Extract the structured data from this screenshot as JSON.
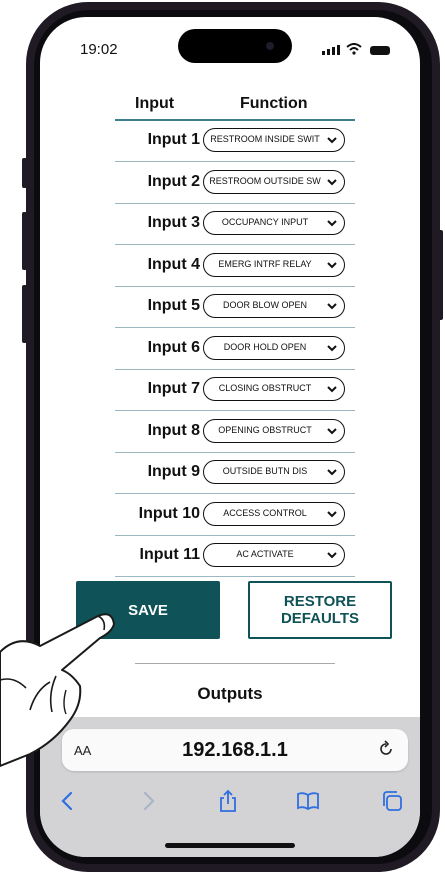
{
  "status_bar": {
    "time": "19:02"
  },
  "table": {
    "header_input": "Input",
    "header_function": "Function",
    "rows": [
      {
        "input": "Input 1",
        "function": "RESTROOM INSIDE SWIT"
      },
      {
        "input": "Input 2",
        "function": "RESTROOM OUTSIDE SW"
      },
      {
        "input": "Input 3",
        "function": "OCCUPANCY INPUT"
      },
      {
        "input": "Input 4",
        "function": "EMERG INTRF RELAY"
      },
      {
        "input": "Input 5",
        "function": "DOOR BLOW OPEN"
      },
      {
        "input": "Input 6",
        "function": "DOOR HOLD OPEN"
      },
      {
        "input": "Input 7",
        "function": "CLOSING OBSTRUCT"
      },
      {
        "input": "Input 8",
        "function": "OPENING OBSTRUCT"
      },
      {
        "input": "Input 9",
        "function": "OUTSIDE BUTN DIS"
      },
      {
        "input": "Input 10",
        "function": "ACCESS CONTROL"
      },
      {
        "input": "Input 11",
        "function": "AC ACTIVATE"
      }
    ]
  },
  "buttons": {
    "save": "SAVE",
    "restore_line1": "RESTORE",
    "restore_line2": "DEFAULTS"
  },
  "outputs_heading": "Outputs",
  "browser": {
    "aa": "AA",
    "url": "192.168.1.1"
  },
  "colors": {
    "accent": "#0f5257",
    "row_line": "#9bb8c2",
    "toolbar_icons": "#2f6fe0"
  }
}
